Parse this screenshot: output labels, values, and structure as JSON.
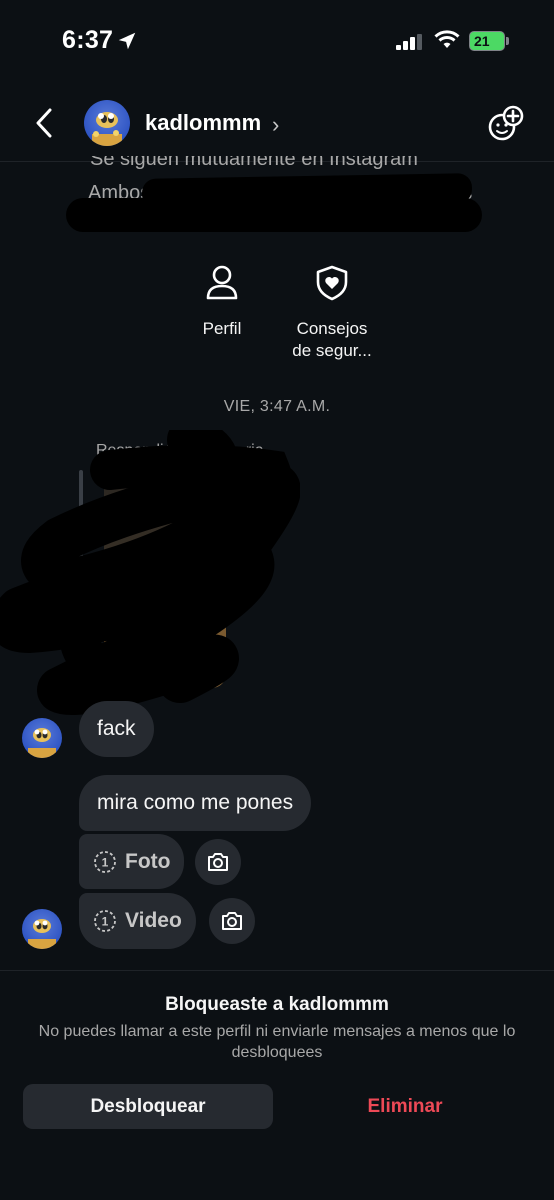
{
  "status_bar": {
    "time": "6:37",
    "battery": "21"
  },
  "header": {
    "username": "kadlommm",
    "chevron": "›",
    "back_icon": "chevron-left-icon",
    "action_icon": "add-people-icon"
  },
  "profile_info": {
    "follow_text": "Se siguen mutuamente en Instagram",
    "both_text_prefix": "Ambos si",
    "both_text_suffix": "s"
  },
  "actions": [
    {
      "label": "Perfil",
      "icon": "person-icon"
    },
    {
      "label_line1": "Consejos",
      "label_line2": "de segur...",
      "icon": "shield-heart-icon"
    }
  ],
  "conversation": {
    "date": "VIE, 3:47 A.M.",
    "replied_label_prefix": "Respondió a",
    "replied_label_suffix": "ria",
    "messages": [
      {
        "text": "fack"
      },
      {
        "text": "mira como me pones"
      }
    ],
    "media": [
      {
        "label": "Foto",
        "icon": "view-once-icon"
      },
      {
        "label": "Video",
        "icon": "view-once-icon"
      }
    ]
  },
  "footer": {
    "blocked_title": "Bloqueaste a kadlommm",
    "blocked_desc": "No puedes llamar a este perfil ni enviarle mensajes a menos que lo desbloquees",
    "unblock_label": "Desbloquear",
    "delete_label": "Eliminar"
  },
  "colors": {
    "background": "#0c1014",
    "bubble": "#262a30",
    "danger": "#ed4956",
    "battery": "#4cd964"
  }
}
